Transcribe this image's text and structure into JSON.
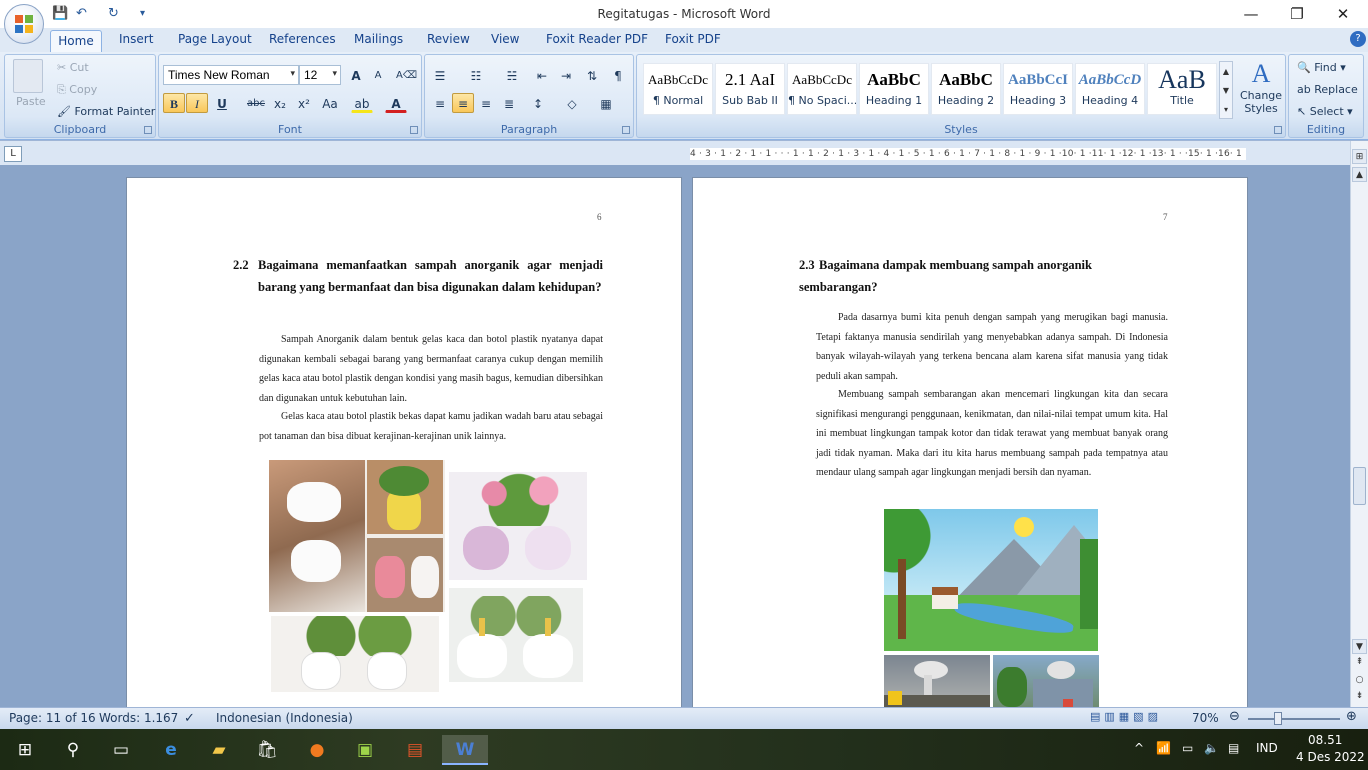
{
  "window": {
    "title": "Regitatugas - Microsoft Word",
    "controls": {
      "minimize": "—",
      "maximize": "❐",
      "close": "✕"
    }
  },
  "quick_access": {
    "save": "💾",
    "undo": "↶",
    "redo": "↻",
    "more": "▾"
  },
  "tabs": [
    "Home",
    "Insert",
    "Page Layout",
    "References",
    "Mailings",
    "Review",
    "View",
    "Foxit Reader PDF",
    "Foxit PDF"
  ],
  "ribbon": {
    "clipboard": {
      "label": "Clipboard",
      "paste": "Paste",
      "cut": "Cut",
      "copy": "Copy",
      "format_painter": "Format Painter"
    },
    "font": {
      "label": "Font",
      "name": "Times New Roman",
      "size": "12",
      "grow": "A",
      "shrink": "A",
      "bold": "B",
      "italic": "I",
      "underline": "U",
      "strike": "abc",
      "sub": "x₂",
      "sup": "x²",
      "case": "Aa",
      "highlight": "ab",
      "color": "A"
    },
    "paragraph": {
      "label": "Paragraph"
    },
    "styles": {
      "label": "Styles",
      "items": [
        {
          "sample": "AaBbCcDc",
          "name": "¶ Normal"
        },
        {
          "sample": "2.1  AaI",
          "name": "Sub Bab II"
        },
        {
          "sample": "AaBbCcDc",
          "name": "¶ No Spaci..."
        },
        {
          "sample": "AaBbC",
          "name": "Heading 1"
        },
        {
          "sample": "AaBbC",
          "name": "Heading 2"
        },
        {
          "sample": "AaBbCcI",
          "name": "Heading 3"
        },
        {
          "sample": "AaBbCcD",
          "name": "Heading 4"
        },
        {
          "sample": "AaB",
          "name": "Title"
        }
      ],
      "change_styles": "Change Styles"
    },
    "editing": {
      "label": "Editing",
      "find": "Find",
      "replace": "Replace",
      "select": "Select"
    }
  },
  "ruler": {
    "text": "4 · 3 · 1 · 2 · 1 · 1 · ·   · 1 · 1 · 2 · 1 · 3 · 1 · 4 · 1 · 5 · 1 · 6 · 1 · 7 · 1 · 8 · 1 · 9 · 1 ·10· 1 ·11· 1 ·12· 1 ·13· 1 ·  ·15· 1 ·16· 1"
  },
  "pages": [
    {
      "number": "6",
      "heading_num": "2.2",
      "heading": "Bagaimana memanfaatkan sampah anorganik agar menjadi barang yang bermanfaat dan bisa digunakan dalam kehidupan?",
      "p1": "Sampah Anorganik dalam bentuk gelas kaca dan botol plastik nyatanya dapat digunakan kembali sebagai barang yang bermanfaat caranya cukup dengan memilih gelas kaca atau botol plastik dengan kondisi yang masih bagus, kemudian dibersihkan dan digunakan untuk kebutuhan lain.",
      "p2": "Gelas kaca atau botol plastik bekas dapat kamu jadikan wadah baru atau sebagai pot tanaman dan bisa dibuat kerajinan-kerajinan unik lainnya."
    },
    {
      "number": "7",
      "heading_num": "2.3",
      "heading": "Bagaimana dampak membuang sampah anorganik sembarangan?",
      "p1": "Pada dasarnya bumi kita penuh dengan sampah yang merugikan bagi manusia. Tetapi faktanya manusia sendirilah yang menyebabkan adanya sampah. Di Indonesia banyak wilayah-wilayah yang terkena bencana alam karena sifat manusia yang tidak peduli akan sampah.",
      "p2": "Membuang sampah sembarangan akan mencemari lingkungan kita dan secara signifikasi mengurangi penggunaan, kenikmatan, dan nilai-nilai tempat umum kita. Hal ini membuat lingkungan tampak kotor dan tidak terawat yang membuat banyak orang jadi tidak nyaman. Maka dari itu kita harus membuang sampah pada tempatnya atau mendaur ulang sampah agar lingkungan menjadi bersih dan nyaman."
    }
  ],
  "status": {
    "page": "Page: 11 of 16",
    "words": "Words: 1.167",
    "language": "Indonesian (Indonesia)",
    "zoom": "70%"
  },
  "taskbar": {
    "lang": "IND",
    "time": "08.51",
    "date": "4 Des 2022"
  },
  "colors": {
    "accent": "#2b579a",
    "ribbon": "#dce8f6",
    "highlight": "#f9c75a"
  }
}
